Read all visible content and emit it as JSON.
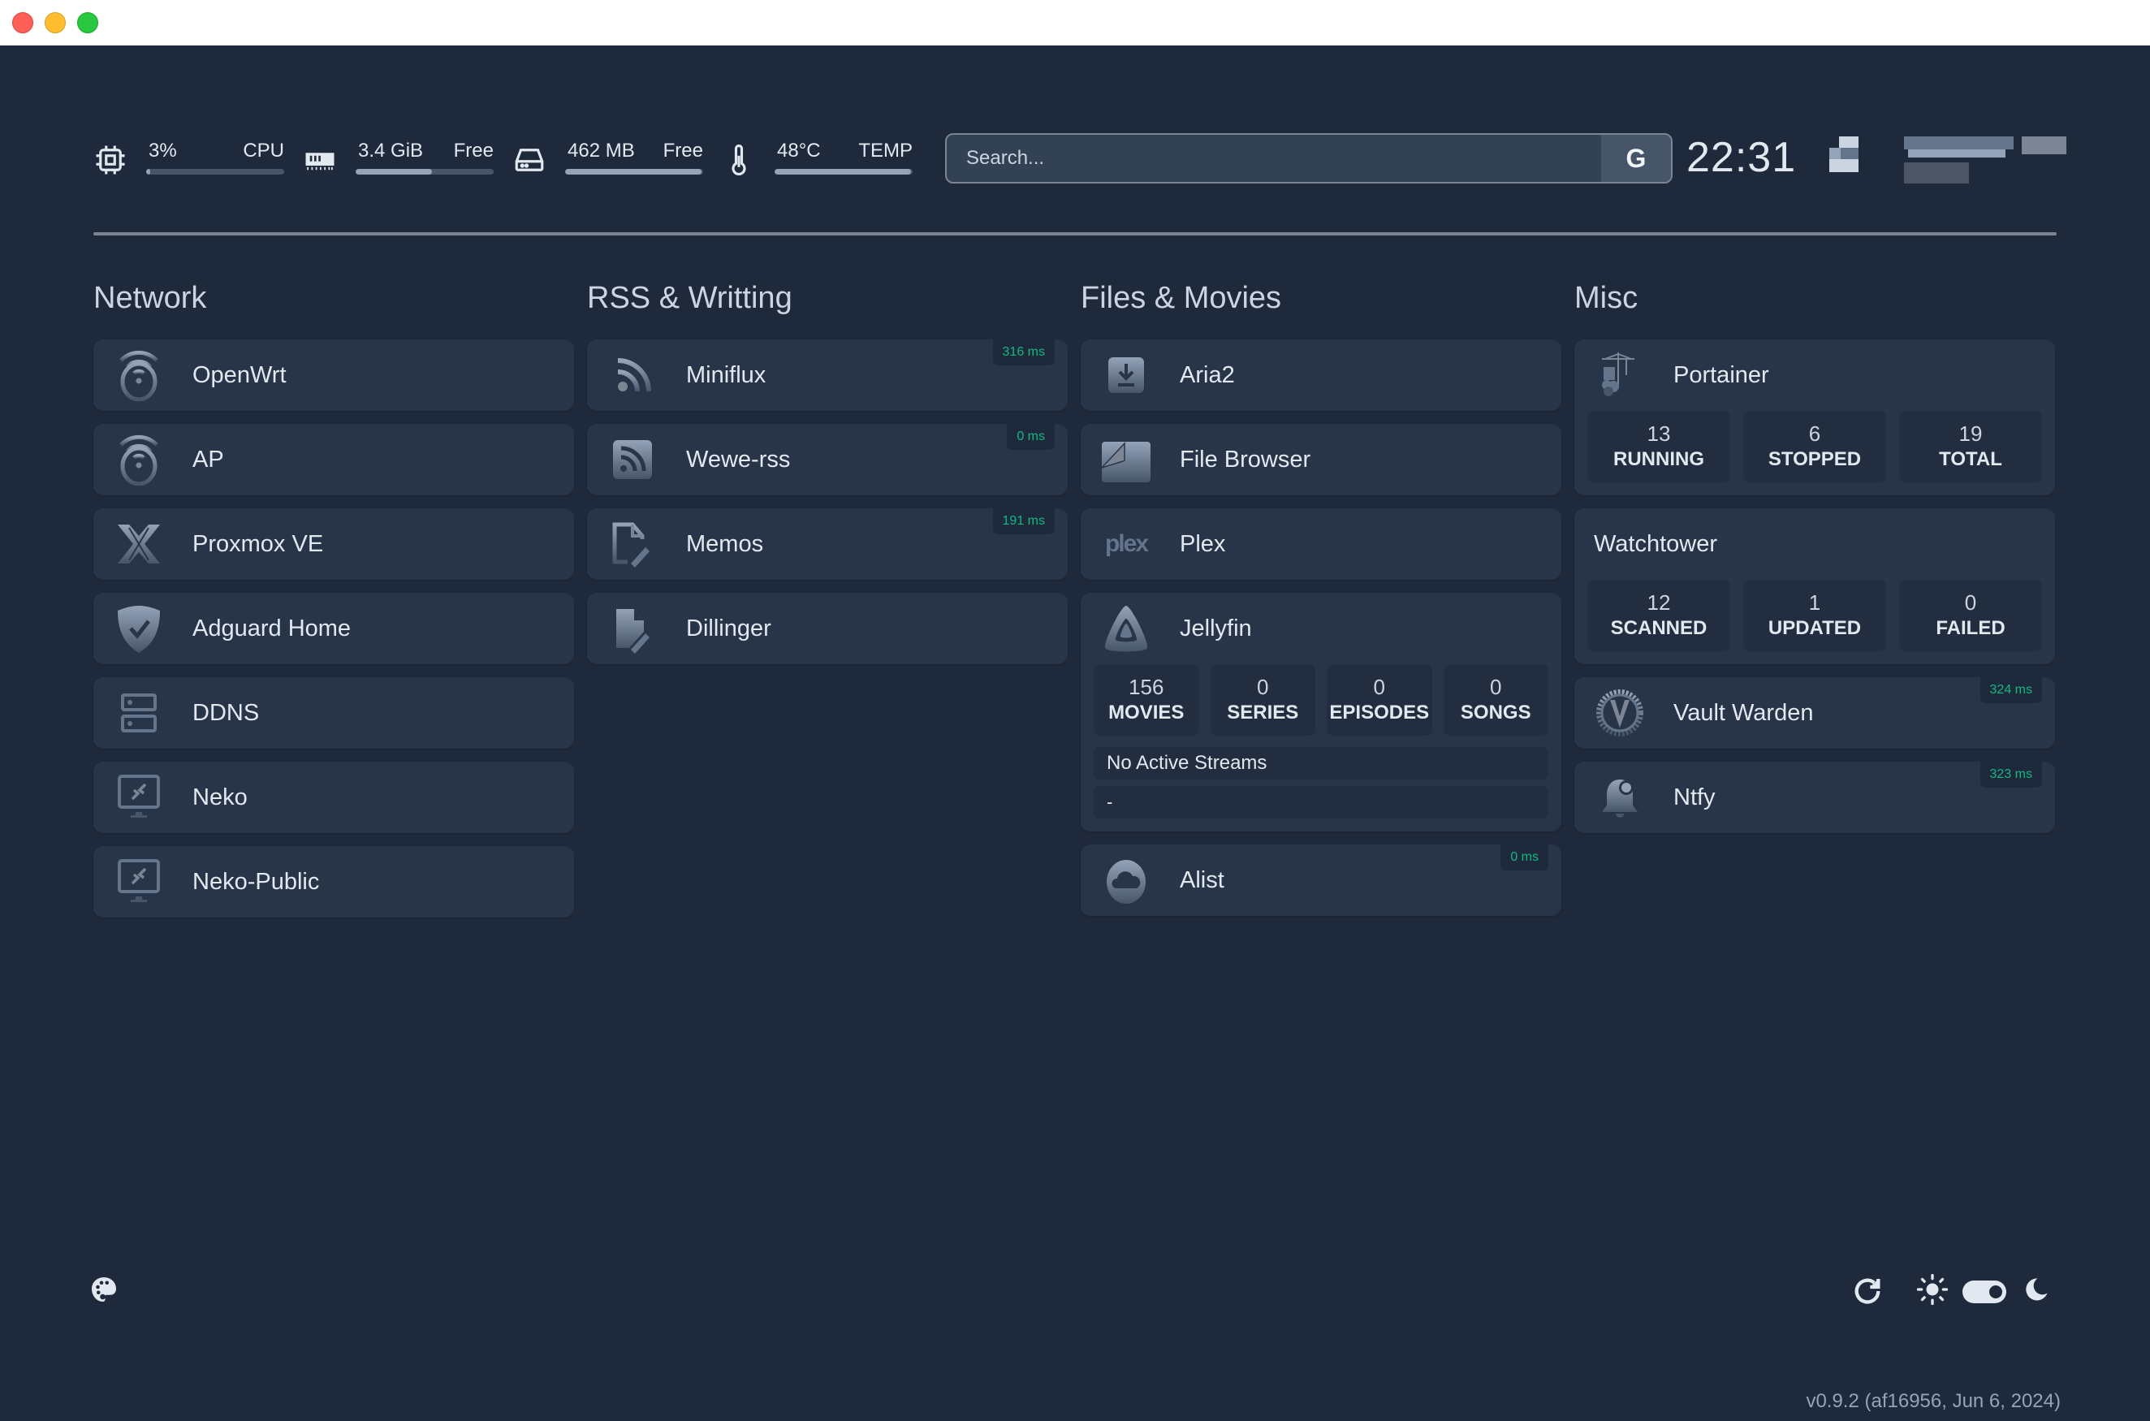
{
  "window": {
    "buttons": [
      "close",
      "minimize",
      "maximize"
    ]
  },
  "header": {
    "resources": [
      {
        "icon": "cpu-icon",
        "value": "3%",
        "label": "CPU",
        "usage_fraction": 0.03
      },
      {
        "icon": "memory-icon",
        "value": "3.4 GiB",
        "label": "Free",
        "usage_fraction": 0.55
      },
      {
        "icon": "disk-icon",
        "value": "462 MB",
        "label": "Free",
        "usage_fraction": 0.99
      },
      {
        "icon": "thermometer-icon",
        "value": "48°C",
        "label": "TEMP",
        "usage_fraction": 0.99
      }
    ],
    "search": {
      "placeholder": "Search...",
      "provider": "G"
    },
    "clock": "22:31"
  },
  "columns": [
    {
      "title": "Network",
      "services": [
        {
          "name": "OpenWrt",
          "icon": "openwrt-icon"
        },
        {
          "name": "AP",
          "icon": "openwrt-icon"
        },
        {
          "name": "Proxmox VE",
          "icon": "proxmox-icon"
        },
        {
          "name": "Adguard Home",
          "icon": "adguard-icon"
        },
        {
          "name": "DDNS",
          "icon": "server-icon"
        },
        {
          "name": "Neko",
          "icon": "remote-desktop-icon"
        },
        {
          "name": "Neko-Public",
          "icon": "remote-desktop-icon"
        }
      ]
    },
    {
      "title": "RSS & Writting",
      "services": [
        {
          "name": "Miniflux",
          "icon": "rss-icon",
          "ping": "316 ms"
        },
        {
          "name": "Wewe-rss",
          "icon": "rss-square-icon",
          "ping": "0 ms"
        },
        {
          "name": "Memos",
          "icon": "edit-file-icon",
          "ping": "191 ms"
        },
        {
          "name": "Dillinger",
          "icon": "edit-file-solid-icon"
        }
      ]
    },
    {
      "title": "Files & Movies",
      "services": [
        {
          "name": "Aria2",
          "icon": "download-icon"
        },
        {
          "name": "File Browser",
          "icon": "filebrowser-icon"
        },
        {
          "name": "Plex",
          "icon": "plex-logo",
          "logo_text": "plex"
        },
        {
          "name": "Jellyfin",
          "icon": "jellyfin-icon",
          "stats": [
            {
              "value": "156",
              "label": "MOVIES"
            },
            {
              "value": "0",
              "label": "SERIES"
            },
            {
              "value": "0",
              "label": "EPISODES"
            },
            {
              "value": "0",
              "label": "SONGS"
            }
          ],
          "streams": "No Active Streams",
          "stream_detail": "-"
        },
        {
          "name": "Alist",
          "icon": "cloud-icon",
          "ping": "0 ms"
        }
      ]
    },
    {
      "title": "Misc",
      "services": [
        {
          "name": "Portainer",
          "icon": "portainer-icon",
          "stats": [
            {
              "value": "13",
              "label": "RUNNING"
            },
            {
              "value": "6",
              "label": "STOPPED"
            },
            {
              "value": "19",
              "label": "TOTAL"
            }
          ]
        },
        {
          "name": "Watchtower",
          "stats": [
            {
              "value": "12",
              "label": "SCANNED"
            },
            {
              "value": "1",
              "label": "UPDATED"
            },
            {
              "value": "0",
              "label": "FAILED"
            }
          ]
        },
        {
          "name": "Vault Warden",
          "icon": "vaultwarden-icon",
          "ping": "324 ms"
        },
        {
          "name": "Ntfy",
          "icon": "bell-icon",
          "ping": "323 ms"
        }
      ]
    }
  ],
  "footer": {
    "theme_toggle": "dark",
    "version": "v0.9.2 (af16956, Jun 6, 2024)"
  },
  "colors": {
    "background": "#1e293b",
    "card": "#283548",
    "ping_text": "#10b981"
  }
}
